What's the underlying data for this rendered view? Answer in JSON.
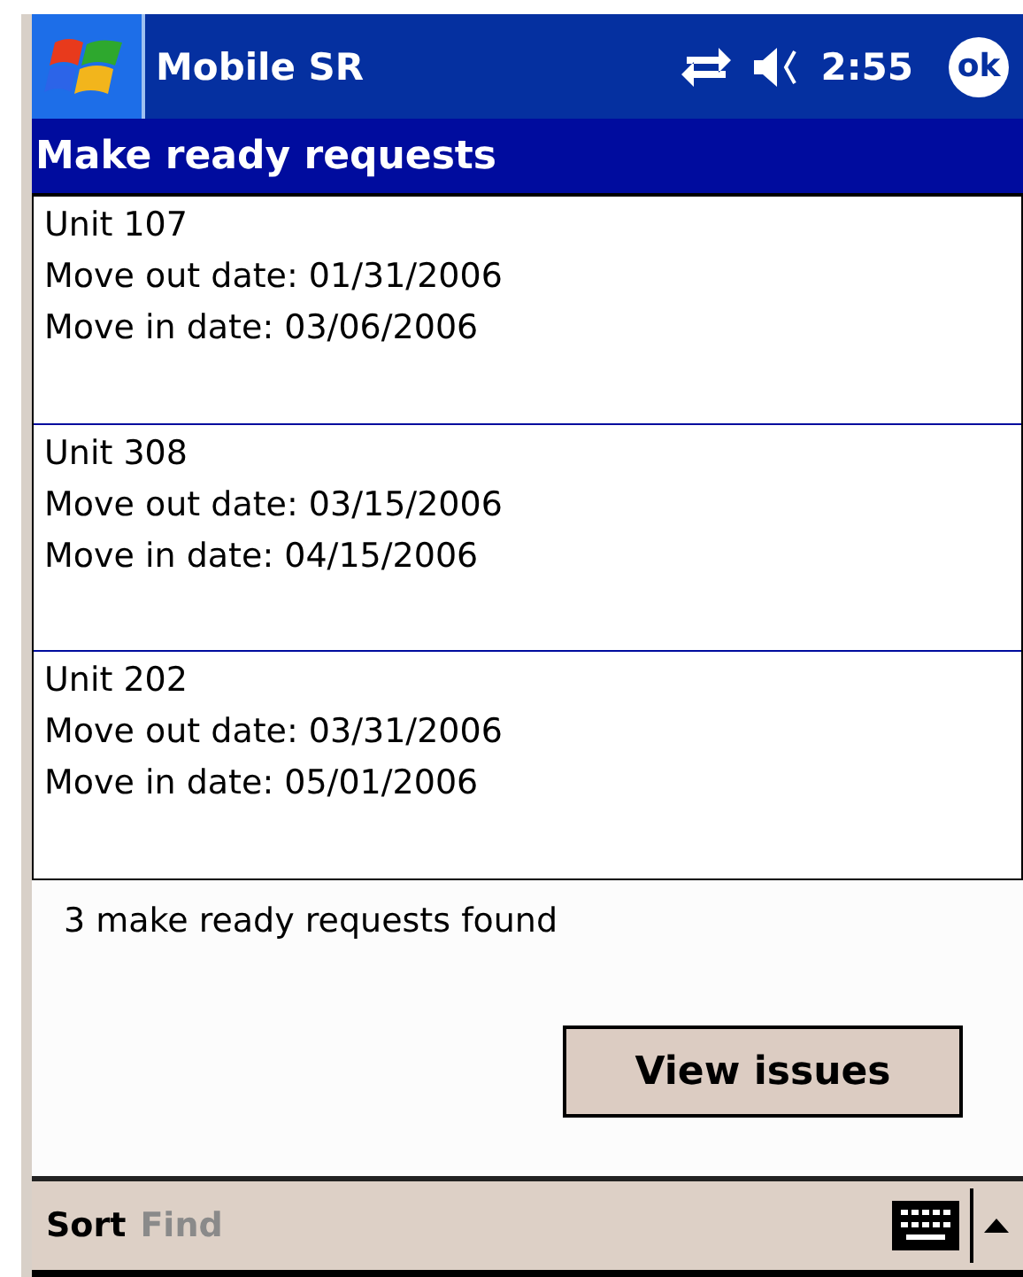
{
  "title_bar": {
    "title": "Mobile SR",
    "time": "2:55",
    "ok": "ok"
  },
  "header": {
    "title": "Make ready requests"
  },
  "requests": [
    {
      "unit": "Unit 107",
      "move_out": "Move out date: 01/31/2006",
      "move_in": "Move in date: 03/06/2006"
    },
    {
      "unit": "Unit 308",
      "move_out": "Move out date: 03/15/2006",
      "move_in": "Move in date: 04/15/2006"
    },
    {
      "unit": "Unit 202",
      "move_out": "Move out date: 03/31/2006",
      "move_in": "Move in date: 05/01/2006"
    }
  ],
  "status": "3 make ready requests found",
  "buttons": [
    "View issues"
  ],
  "menu_bar": {
    "items": [
      {
        "label": "Sort",
        "disabled": false
      },
      {
        "label": "Find",
        "disabled": true
      }
    ]
  }
}
